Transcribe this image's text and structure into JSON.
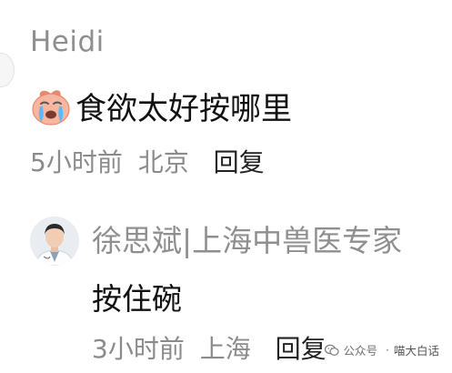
{
  "comments": [
    {
      "username": "Heidi",
      "text": "食欲太好按哪里",
      "time": "5小时前",
      "location": "北京",
      "reply_label": "回复",
      "emoji_icon": "crying-peach-face-icon"
    },
    {
      "username": "徐思斌|上海中兽医专家",
      "text": "按住碗",
      "time": "3小时前",
      "location": "上海",
      "reply_label": "回复",
      "avatar_icon": "doctor-avatar"
    }
  ],
  "watermark": {
    "label": "公众号",
    "separator": "·",
    "account": "喵大白话",
    "icon": "wechat-icon"
  }
}
